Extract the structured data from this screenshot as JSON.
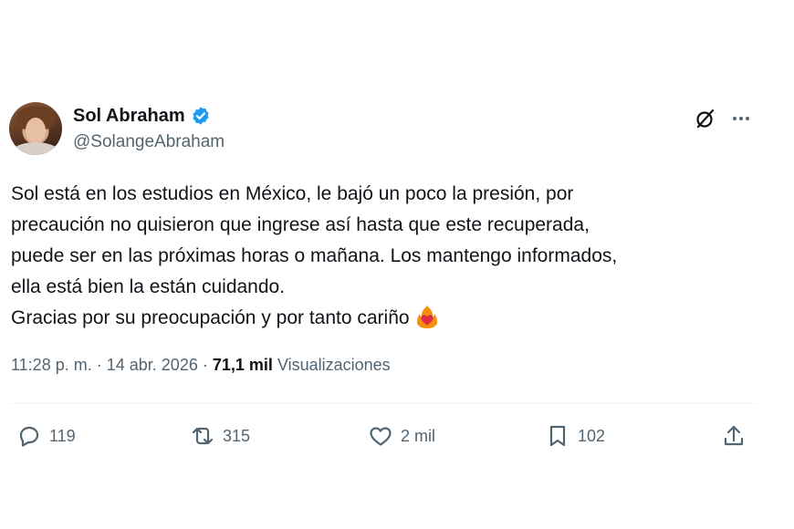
{
  "author": {
    "display_name": "Sol Abraham",
    "handle": "@SolangeAbraham",
    "verified": true
  },
  "header_icons": [
    "grok-icon",
    "more-options-icon"
  ],
  "tweet": {
    "lines": [
      "Sol está en los estudios en México, le bajó un poco la presión, por",
      "precaución no quisieron que ingrese así hasta que este recuperada,",
      "puede ser en las próximas horas o mañana. Los mantengo informados,",
      "ella está bien la están cuidando.",
      "Gracias por su preocupación y por tanto cariño"
    ],
    "emoji": "heart-on-fire-emoji"
  },
  "meta": {
    "time": "11:28 p. m.",
    "separator": "·",
    "date": "14 abr. 2026",
    "views_count": "71,1 mil",
    "views_label": "Visualizaciones"
  },
  "actions": {
    "replies": "119",
    "reposts": "315",
    "likes": "2 mil",
    "bookmarks": "102"
  },
  "colors": {
    "text": "#0f1419",
    "secondary": "#536471",
    "verified": "#1d9bf0",
    "divider": "#eff3f4"
  }
}
